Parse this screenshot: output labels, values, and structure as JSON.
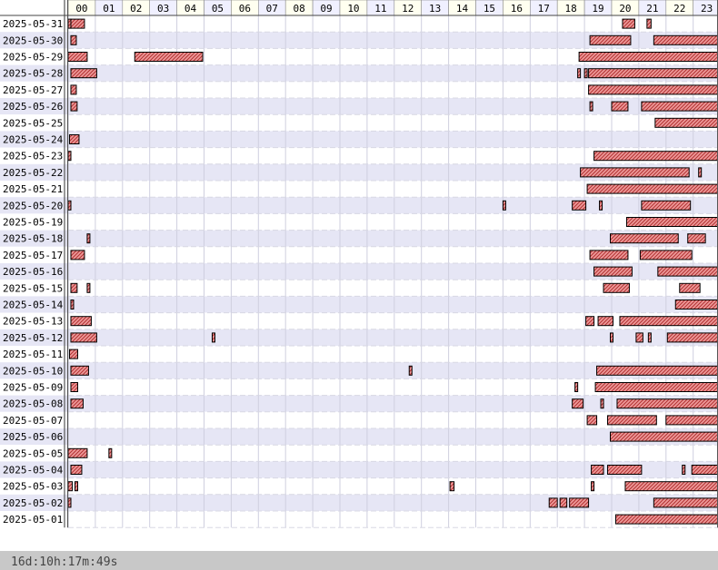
{
  "footer_text": "16d:10h:17m:49s",
  "colors": {
    "bar_fill": "#ee9999",
    "bar_hatch": "#b03030",
    "bar_stroke": "#000000",
    "row_alt": "#e6e6f5",
    "row_base": "#ffffff",
    "hour_header_odd": "#fffff0",
    "hour_header_even": "#f0f0ff",
    "footer_bg": "#c8c8c8",
    "footer_text": "#444444"
  },
  "chart_data": {
    "type": "timeline",
    "x_unit": "hour of day",
    "xlim": [
      0,
      24
    ],
    "hours": [
      "00",
      "01",
      "02",
      "03",
      "04",
      "05",
      "06",
      "07",
      "08",
      "09",
      "10",
      "11",
      "12",
      "13",
      "14",
      "15",
      "16",
      "17",
      "18",
      "19",
      "20",
      "21",
      "22",
      "23"
    ],
    "grid": true,
    "rows": [
      {
        "date": "2025-05-31",
        "intervals": [
          [
            0.0,
            0.05
          ],
          [
            0.1,
            0.6
          ],
          [
            20.4,
            20.85
          ],
          [
            21.3,
            21.45
          ]
        ]
      },
      {
        "date": "2025-05-30",
        "intervals": [
          [
            0.1,
            0.3
          ],
          [
            19.2,
            20.7
          ],
          [
            21.55,
            23.9
          ]
        ]
      },
      {
        "date": "2025-05-29",
        "intervals": [
          [
            0.0,
            0.7
          ],
          [
            2.45,
            4.95
          ],
          [
            18.8,
            23.9
          ]
        ]
      },
      {
        "date": "2025-05-28",
        "intervals": [
          [
            0.1,
            1.05
          ],
          [
            18.75,
            18.82
          ],
          [
            19.0,
            19.1
          ],
          [
            19.15,
            23.95
          ]
        ]
      },
      {
        "date": "2025-05-27",
        "intervals": [
          [
            0.1,
            0.3
          ],
          [
            19.15,
            23.9
          ]
        ]
      },
      {
        "date": "2025-05-26",
        "intervals": [
          [
            0.1,
            0.33
          ],
          [
            19.2,
            19.3
          ],
          [
            20.0,
            20.6
          ],
          [
            21.1,
            23.9
          ]
        ]
      },
      {
        "date": "2025-05-25",
        "intervals": [
          [
            21.6,
            23.9
          ]
        ]
      },
      {
        "date": "2025-05-24",
        "intervals": [
          [
            0.05,
            0.4
          ]
        ]
      },
      {
        "date": "2025-05-23",
        "intervals": [
          [
            0.0,
            0.1
          ],
          [
            19.35,
            23.9
          ]
        ]
      },
      {
        "date": "2025-05-22",
        "intervals": [
          [
            18.85,
            22.85
          ],
          [
            23.2,
            23.3
          ]
        ]
      },
      {
        "date": "2025-05-21",
        "intervals": [
          [
            19.1,
            23.9
          ]
        ]
      },
      {
        "date": "2025-05-20",
        "intervals": [
          [
            0.0,
            0.1
          ],
          [
            16.0,
            16.05
          ],
          [
            18.55,
            19.05
          ],
          [
            19.55,
            19.65
          ],
          [
            21.1,
            22.9
          ]
        ]
      },
      {
        "date": "2025-05-19",
        "intervals": [
          [
            20.55,
            23.9
          ]
        ]
      },
      {
        "date": "2025-05-18",
        "intervals": [
          [
            0.7,
            0.78
          ],
          [
            19.95,
            22.45
          ],
          [
            22.8,
            23.45
          ]
        ]
      },
      {
        "date": "2025-05-17",
        "intervals": [
          [
            0.1,
            0.6
          ],
          [
            19.2,
            20.6
          ],
          [
            21.05,
            22.95
          ]
        ]
      },
      {
        "date": "2025-05-16",
        "intervals": [
          [
            19.35,
            20.75
          ],
          [
            21.7,
            23.9
          ]
        ]
      },
      {
        "date": "2025-05-15",
        "intervals": [
          [
            0.1,
            0.33
          ],
          [
            0.7,
            0.8
          ],
          [
            19.7,
            20.65
          ],
          [
            22.5,
            23.25
          ]
        ]
      },
      {
        "date": "2025-05-14",
        "intervals": [
          [
            0.1,
            0.2
          ],
          [
            22.35,
            23.9
          ]
        ]
      },
      {
        "date": "2025-05-13",
        "intervals": [
          [
            0.1,
            0.85
          ],
          [
            19.05,
            19.35
          ],
          [
            19.5,
            20.05
          ],
          [
            20.3,
            23.9
          ]
        ]
      },
      {
        "date": "2025-05-12",
        "intervals": [
          [
            0.1,
            1.05
          ],
          [
            5.3,
            5.35
          ],
          [
            19.95,
            20.0
          ],
          [
            20.9,
            21.15
          ],
          [
            21.35,
            21.45
          ],
          [
            22.05,
            23.9
          ]
        ]
      },
      {
        "date": "2025-05-11",
        "intervals": [
          [
            0.05,
            0.35
          ]
        ]
      },
      {
        "date": "2025-05-10",
        "intervals": [
          [
            0.1,
            0.75
          ],
          [
            12.55,
            12.65
          ],
          [
            19.45,
            23.95
          ]
        ]
      },
      {
        "date": "2025-05-09",
        "intervals": [
          [
            0.1,
            0.35
          ],
          [
            18.65,
            18.7
          ],
          [
            19.4,
            23.9
          ]
        ]
      },
      {
        "date": "2025-05-08",
        "intervals": [
          [
            0.1,
            0.55
          ],
          [
            18.55,
            18.95
          ],
          [
            19.6,
            19.65
          ],
          [
            20.2,
            23.9
          ]
        ]
      },
      {
        "date": "2025-05-07",
        "intervals": [
          [
            19.1,
            19.45
          ],
          [
            19.85,
            21.65
          ],
          [
            22.0,
            23.9
          ]
        ]
      },
      {
        "date": "2025-05-06",
        "intervals": [
          [
            19.95,
            23.9
          ]
        ]
      },
      {
        "date": "2025-05-05",
        "intervals": [
          [
            0.0,
            0.7
          ],
          [
            1.5,
            1.55
          ]
        ]
      },
      {
        "date": "2025-05-04",
        "intervals": [
          [
            0.1,
            0.5
          ],
          [
            19.25,
            19.7
          ],
          [
            19.85,
            21.1
          ],
          [
            22.6,
            22.7
          ],
          [
            22.95,
            23.9
          ]
        ]
      },
      {
        "date": "2025-05-03",
        "intervals": [
          [
            0.0,
            0.15
          ],
          [
            0.25,
            0.3
          ],
          [
            14.05,
            14.2
          ],
          [
            19.25,
            19.35
          ],
          [
            20.5,
            23.9
          ]
        ]
      },
      {
        "date": "2025-05-02",
        "intervals": [
          [
            0.0,
            0.05
          ],
          [
            17.7,
            18.0
          ],
          [
            18.1,
            18.35
          ],
          [
            18.45,
            19.15
          ],
          [
            21.55,
            23.9
          ]
        ]
      },
      {
        "date": "2025-05-01",
        "intervals": [
          [
            20.15,
            23.9
          ]
        ]
      }
    ]
  }
}
